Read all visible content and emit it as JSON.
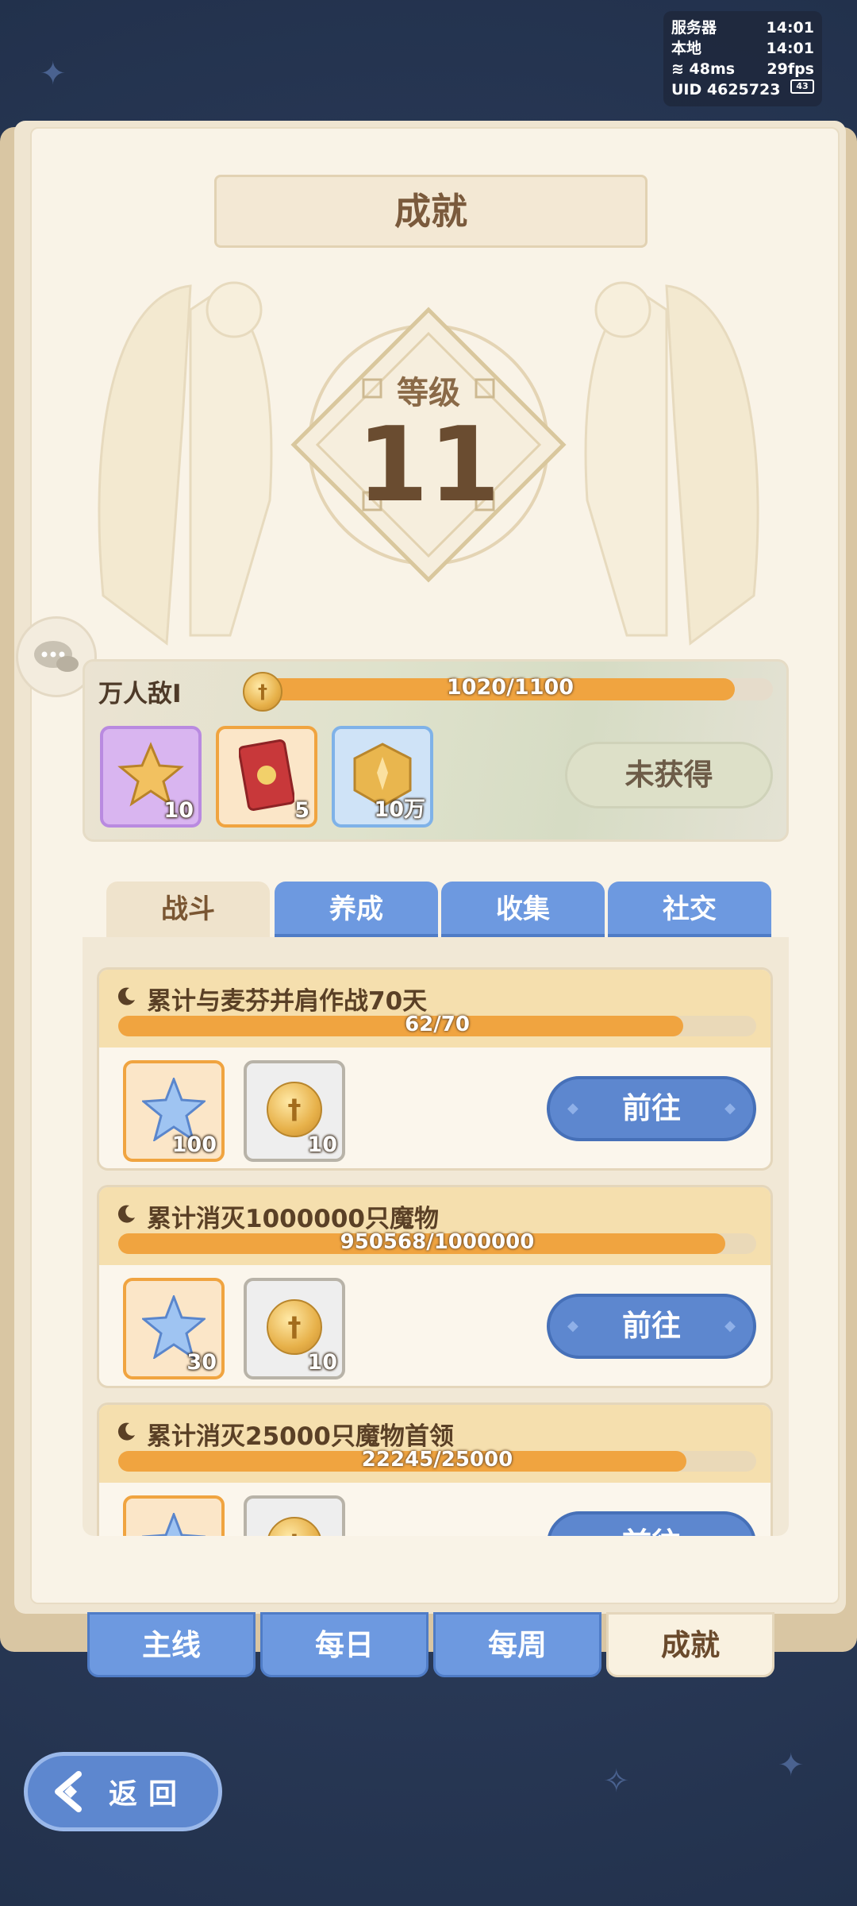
{
  "status": {
    "server_label": "服务器",
    "server_time": "14:01",
    "local_label": "本地",
    "local_time": "14:01",
    "ping": "48ms",
    "fps": "29fps",
    "uid": "UID 4625723",
    "battery": "43"
  },
  "title": "成就",
  "level": {
    "label": "等级",
    "value": "11"
  },
  "rank": {
    "name": "万人敌I",
    "progress_text": "1020/1100",
    "progress": 0.927
  },
  "rank_rewards": [
    {
      "icon": "star-badge-icon",
      "qty": "10",
      "rarity": "purple"
    },
    {
      "icon": "card-icon",
      "qty": "5",
      "rarity": "orange"
    },
    {
      "icon": "gold-coin-icon",
      "qty": "10万",
      "rarity": "blue"
    }
  ],
  "rank_status_button": "未获得",
  "category_tabs": [
    {
      "label": "战斗",
      "active": true
    },
    {
      "label": "养成",
      "active": false
    },
    {
      "label": "收集",
      "active": false
    },
    {
      "label": "社交",
      "active": false
    }
  ],
  "achievements": [
    {
      "title": "累计与麦芬并肩作战70天",
      "progress_text": "62/70",
      "progress": 0.886,
      "rewards": [
        {
          "icon": "crystal-star-icon",
          "qty": "100"
        },
        {
          "icon": "winged-coin-icon",
          "qty": "10"
        }
      ],
      "button": "前往"
    },
    {
      "title": "累计消灭1000000只魔物",
      "progress_text": "950568/1000000",
      "progress": 0.951,
      "rewards": [
        {
          "icon": "crystal-star-icon",
          "qty": "30"
        },
        {
          "icon": "winged-coin-icon",
          "qty": "10"
        }
      ],
      "button": "前往"
    },
    {
      "title": "累计消灭25000只魔物首领",
      "progress_text": "22245/25000",
      "progress": 0.89,
      "rewards": [
        {
          "icon": "crystal-star-icon",
          "qty": ""
        },
        {
          "icon": "winged-coin-icon",
          "qty": ""
        }
      ],
      "button": "前往"
    }
  ],
  "bottom_tabs": [
    {
      "label": "主线",
      "active": false
    },
    {
      "label": "每日",
      "active": false
    },
    {
      "label": "每周",
      "active": false
    },
    {
      "label": "成就",
      "active": true
    }
  ],
  "back_button": "返回"
}
